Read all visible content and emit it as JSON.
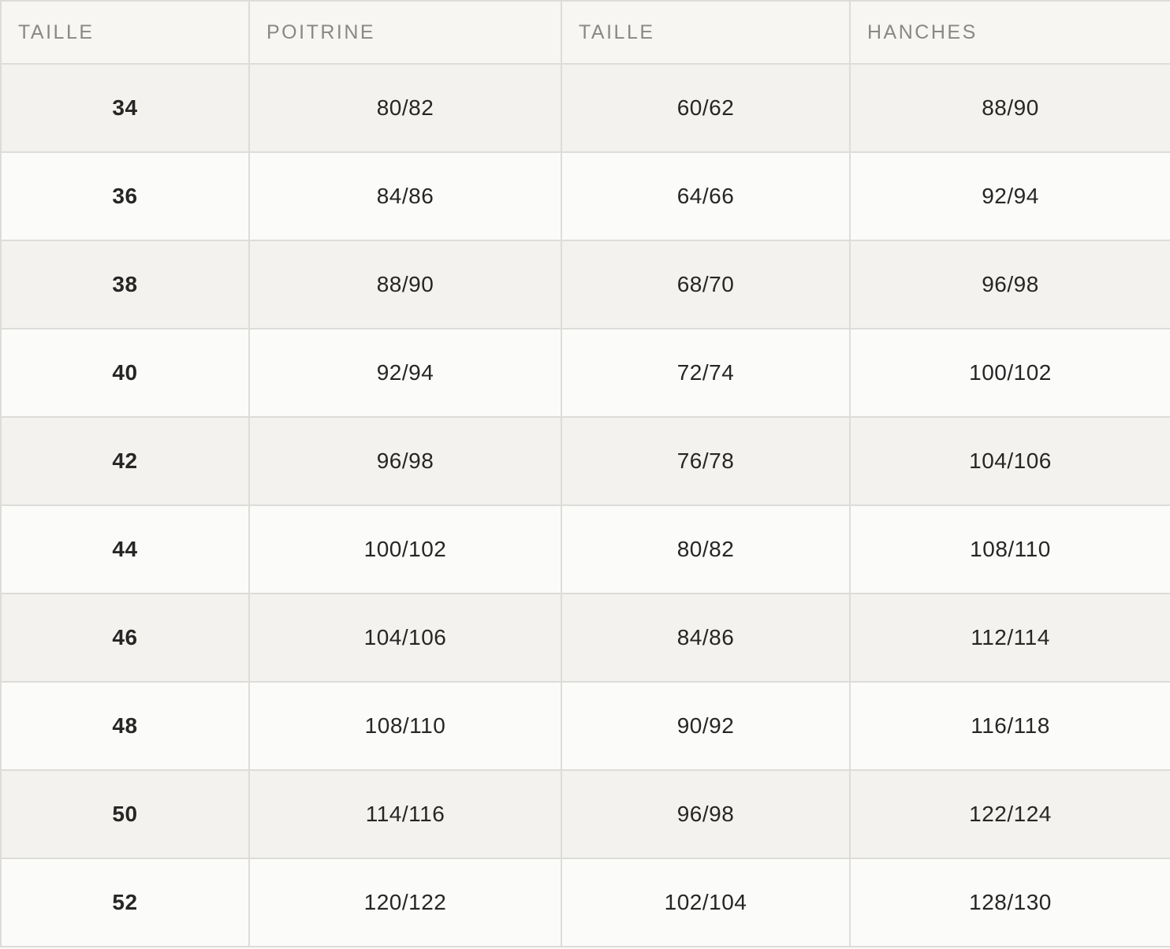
{
  "table": {
    "headers": [
      "TAILLE",
      "POITRINE",
      "TAILLE",
      "HANCHES"
    ],
    "rows": [
      {
        "size": "34",
        "poitrine": "80/82",
        "taille": "60/62",
        "hanches": "88/90"
      },
      {
        "size": "36",
        "poitrine": "84/86",
        "taille": "64/66",
        "hanches": "92/94"
      },
      {
        "size": "38",
        "poitrine": "88/90",
        "taille": "68/70",
        "hanches": "96/98"
      },
      {
        "size": "40",
        "poitrine": "92/94",
        "taille": "72/74",
        "hanches": "100/102"
      },
      {
        "size": "42",
        "poitrine": "96/98",
        "taille": "76/78",
        "hanches": "104/106"
      },
      {
        "size": "44",
        "poitrine": "100/102",
        "taille": "80/82",
        "hanches": "108/110"
      },
      {
        "size": "46",
        "poitrine": "104/106",
        "taille": "84/86",
        "hanches": "112/114"
      },
      {
        "size": "48",
        "poitrine": "108/110",
        "taille": "90/92",
        "hanches": "116/118"
      },
      {
        "size": "50",
        "poitrine": "114/116",
        "taille": "96/98",
        "hanches": "122/124"
      },
      {
        "size": "52",
        "poitrine": "120/122",
        "taille": "102/104",
        "hanches": "128/130"
      }
    ]
  },
  "colors": {
    "header_bg": "#f7f6f2",
    "header_text": "#8a8885",
    "row_odd_bg": "#f3f2ee",
    "row_even_bg": "#fbfbfa",
    "border": "#dedcd8",
    "text": "#262626"
  }
}
